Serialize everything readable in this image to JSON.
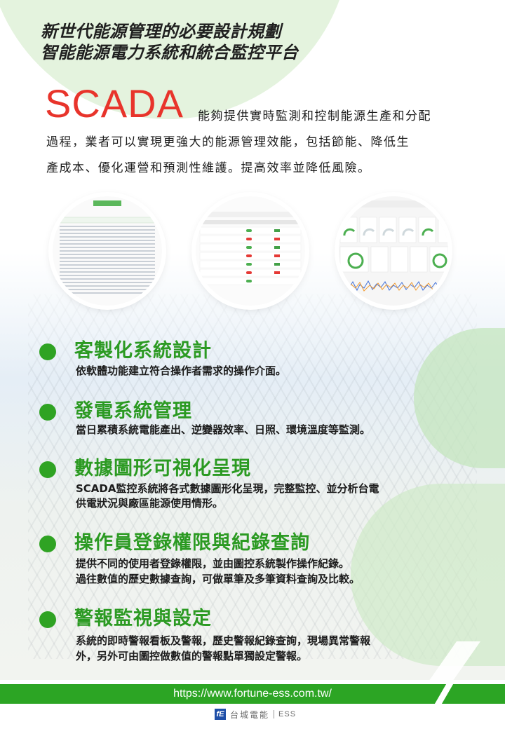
{
  "header": {
    "title_line1": "新世代能源管理的必要設計規劃",
    "title_line2": "智能能源電力系統和統合監控平台"
  },
  "scada_word": "SCADA",
  "intro": {
    "line1": "能夠提供實時監測和控制能源生產和分配",
    "line2": "過程，業者可以實現更強大的能源管理效能，包括節能、降低生",
    "line3": "產成本、優化運營和預測性維護。提高效率並降低風險。"
  },
  "features": [
    {
      "title": "客製化系統設計",
      "desc1": "依軟體功能建立符合操作者需求的操作介面。",
      "desc2": ""
    },
    {
      "title": "發電系統管理",
      "desc1": "當日累積系統電能產出、逆變器效率、日照、環境溫度等監測。",
      "desc2": ""
    },
    {
      "title": "數據圖形可視化呈現",
      "desc1": "SCADA監控系統將各式數據圖形化呈現，完整監控、並分析台電",
      "desc2": "供電狀況與廠區能源使用情形。"
    },
    {
      "title": "操作員登錄權限與紀錄查詢",
      "desc1": "提供不同的使用者登錄權限，並由圖控系統製作操作紀錄。",
      "desc2": "過往數值的歷史數據查詢，可做單筆及多筆資料查詢及比較。"
    },
    {
      "title": "警報監視與設定",
      "desc1": "系統的即時警報看板及警報，歷史警報紀錄查詢，現場異常警報",
      "desc2": "外，另外可由圖控做數值的警報點單獨設定警報。"
    }
  ],
  "footer": {
    "url": "https://www.fortune-ess.com.tw/",
    "logo_text": "台城電能",
    "logo_ess": "ESS"
  },
  "colors": {
    "accent_green": "#2ca524",
    "scada_red": "#e8342b",
    "logo_blue": "#1f4fa8"
  },
  "icons": [
    "bullet-dot-icon",
    "company-logo-icon"
  ]
}
